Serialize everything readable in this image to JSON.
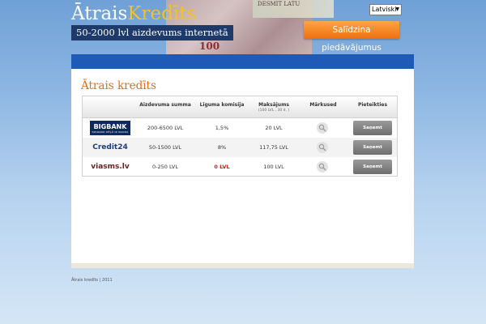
{
  "header": {
    "logo_part1": "Ātrais",
    "logo_part2": "Kredīts",
    "slogan": "50-2000 lvl aizdevums internetā",
    "language": "Latviski",
    "compare_button": "Salīdzina piedāvājumus",
    "banknote_texts": [
      "DESMIT LATU",
      "100"
    ]
  },
  "main": {
    "title": "Ātrais kredīts",
    "table": {
      "headers": {
        "amount": "Aizdevuma summa",
        "commission": "Līguma komisija",
        "payments": "Maksājums",
        "payments_sub": "(100 LVL , 30 d. )",
        "brands": "Mārkused",
        "apply": "Pieteikties"
      },
      "rows": [
        {
          "lender": "BIGBANK",
          "lender_sub": "SPARAND DĒĻŪ IZ NAUDA",
          "amount": "200-6500 LVL",
          "commission": "1,5%",
          "payment": "20 LVL",
          "button": "Saņemt kredītu »"
        },
        {
          "lender": "Credit24",
          "amount": "50-1500 LVL",
          "commission": "8%",
          "payment": "117,75 LVL",
          "button": "Saņemt kredītu »"
        },
        {
          "lender": "viasms.lv",
          "amount": "0-250 LVL",
          "commission": "0 LVL",
          "payment": "100 LVL",
          "button": "Saņemt kredītu »"
        }
      ]
    }
  },
  "footer": {
    "text": "Ātrais kredīts | 2011"
  },
  "colors": {
    "accent": "#e66a10",
    "nav": "#1f5ab6",
    "logo_gold": "#f2c12e",
    "highlight_red": "#c41a1a"
  }
}
